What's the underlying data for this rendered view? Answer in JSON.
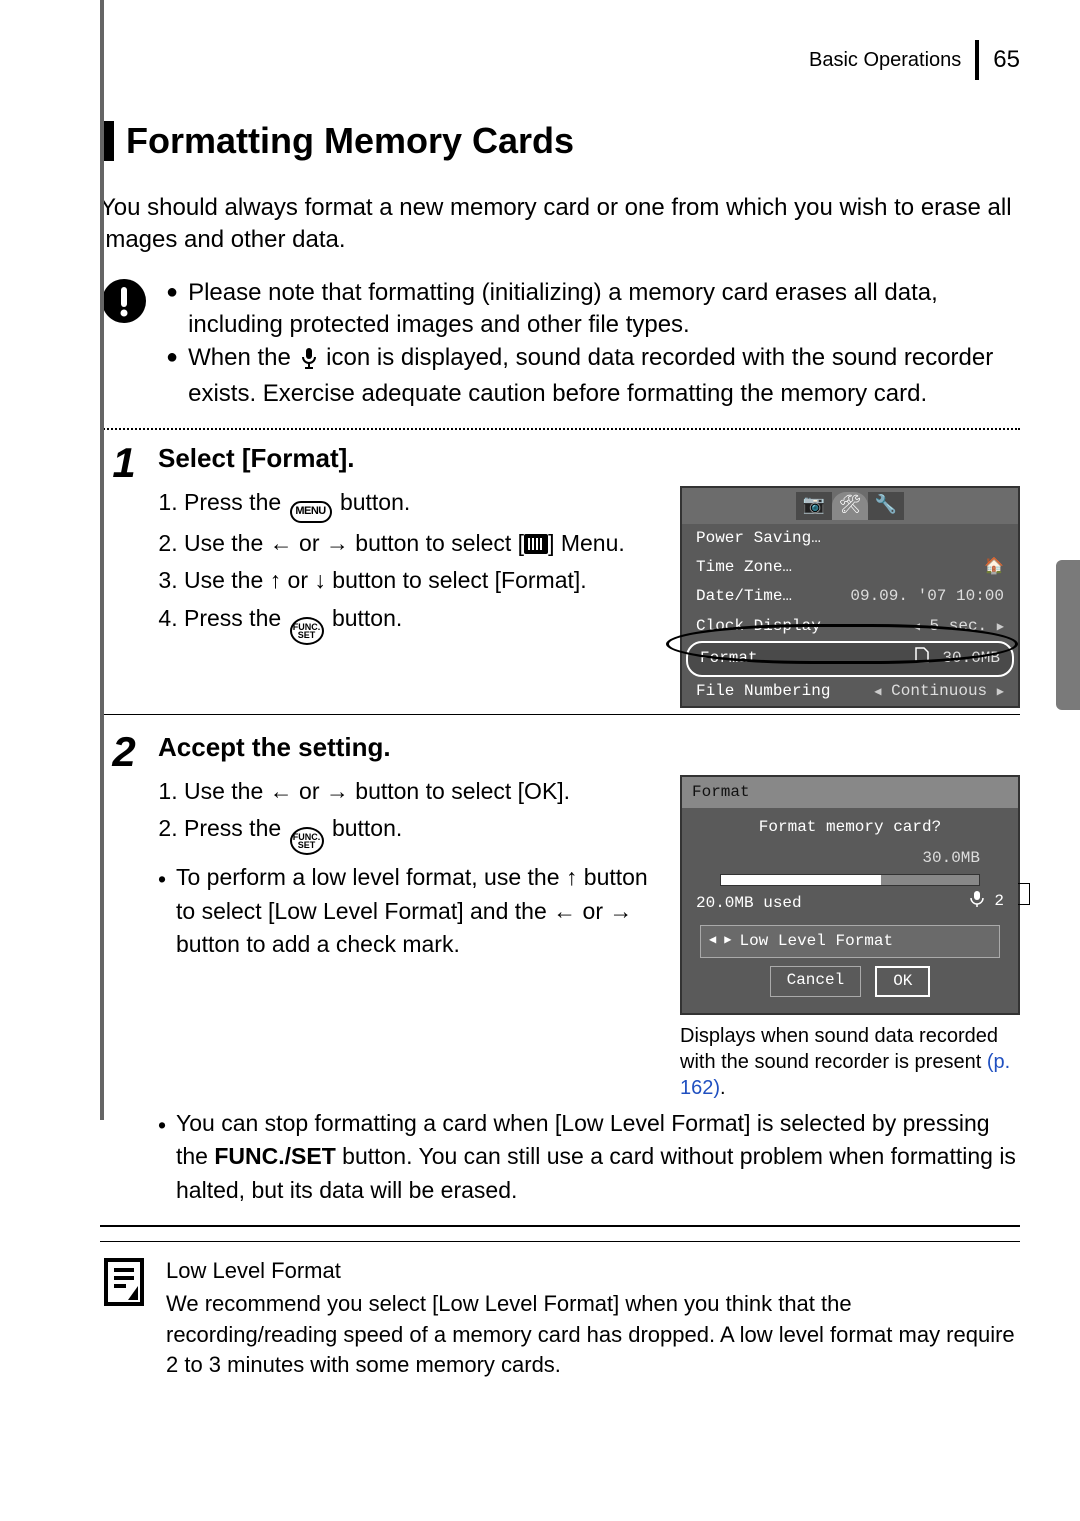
{
  "header": {
    "chapter": "Basic Operations",
    "page": "65"
  },
  "title": "Formatting Memory Cards",
  "intro": "You should always format a new memory card or one from which you wish to erase all images and other data.",
  "warning": {
    "b1": "Please note that formatting (initializing) a memory card erases all data, including protected images and other file types.",
    "b2a": "When the",
    "b2b": "icon is displayed, sound data recorded with the sound recorder exists. Exercise adequate caution before formatting the memory card."
  },
  "step1": {
    "num": "1",
    "title": "Select [Format].",
    "s1a": "Press the",
    "s1b": "button.",
    "s2a": "Use the",
    "s2b": "or",
    "s2c": "button to select [",
    "s2d": "] Menu.",
    "s3a": "Use the",
    "s3b": "or",
    "s3c": "button to select [Format].",
    "s4a": "Press the",
    "s4b": "button.",
    "menuLabel": "MENU",
    "funcLabel1": "FUNC.",
    "funcLabel2": "SET"
  },
  "lcd1": {
    "r1": "Power Saving…",
    "r2": "Time Zone…",
    "r3l": "Date/Time…",
    "r3v": "09.09. '07 10:00",
    "r4l": "Clock Display",
    "r4v": "5 sec.",
    "r5l": "Format…",
    "r5v": "30.0MB",
    "r6l": "File Numbering",
    "r6v": "Continuous"
  },
  "step2": {
    "num": "2",
    "title": "Accept the setting.",
    "s1a": "Use the",
    "s1b": "or",
    "s1c": "button to select [OK].",
    "s2a": "Press the",
    "s2b": "button.",
    "n1a": "To perform a low level format, use the",
    "n1b": "button to select [Low Level Format] and the",
    "n1c": "or",
    "n1d": "button to add a check mark.",
    "n2a": "You can stop formatting a card when [Low Level Format] is selected by pressing the ",
    "n2b": "FUNC./SET",
    "n2c": " button. You can still use a card without problem when formatting is halted, but its data will be erased."
  },
  "lcd2": {
    "title": "Format",
    "q": "Format memory card?",
    "cap": "30.0MB",
    "used": "20.0MB used",
    "soundCount": "2",
    "llf": "Low Level Format",
    "cancel": "Cancel",
    "ok": "OK"
  },
  "soundCaption": {
    "text": "Displays when sound data recorded with the sound recorder is present ",
    "link": "(p. 162)",
    "tail": "."
  },
  "note": {
    "title": "Low Level Format",
    "body": "We recommend you select [Low Level Format] when you think that the recording/reading speed of a memory card has dropped. A low level format may require 2 to 3 minutes with some memory cards."
  }
}
